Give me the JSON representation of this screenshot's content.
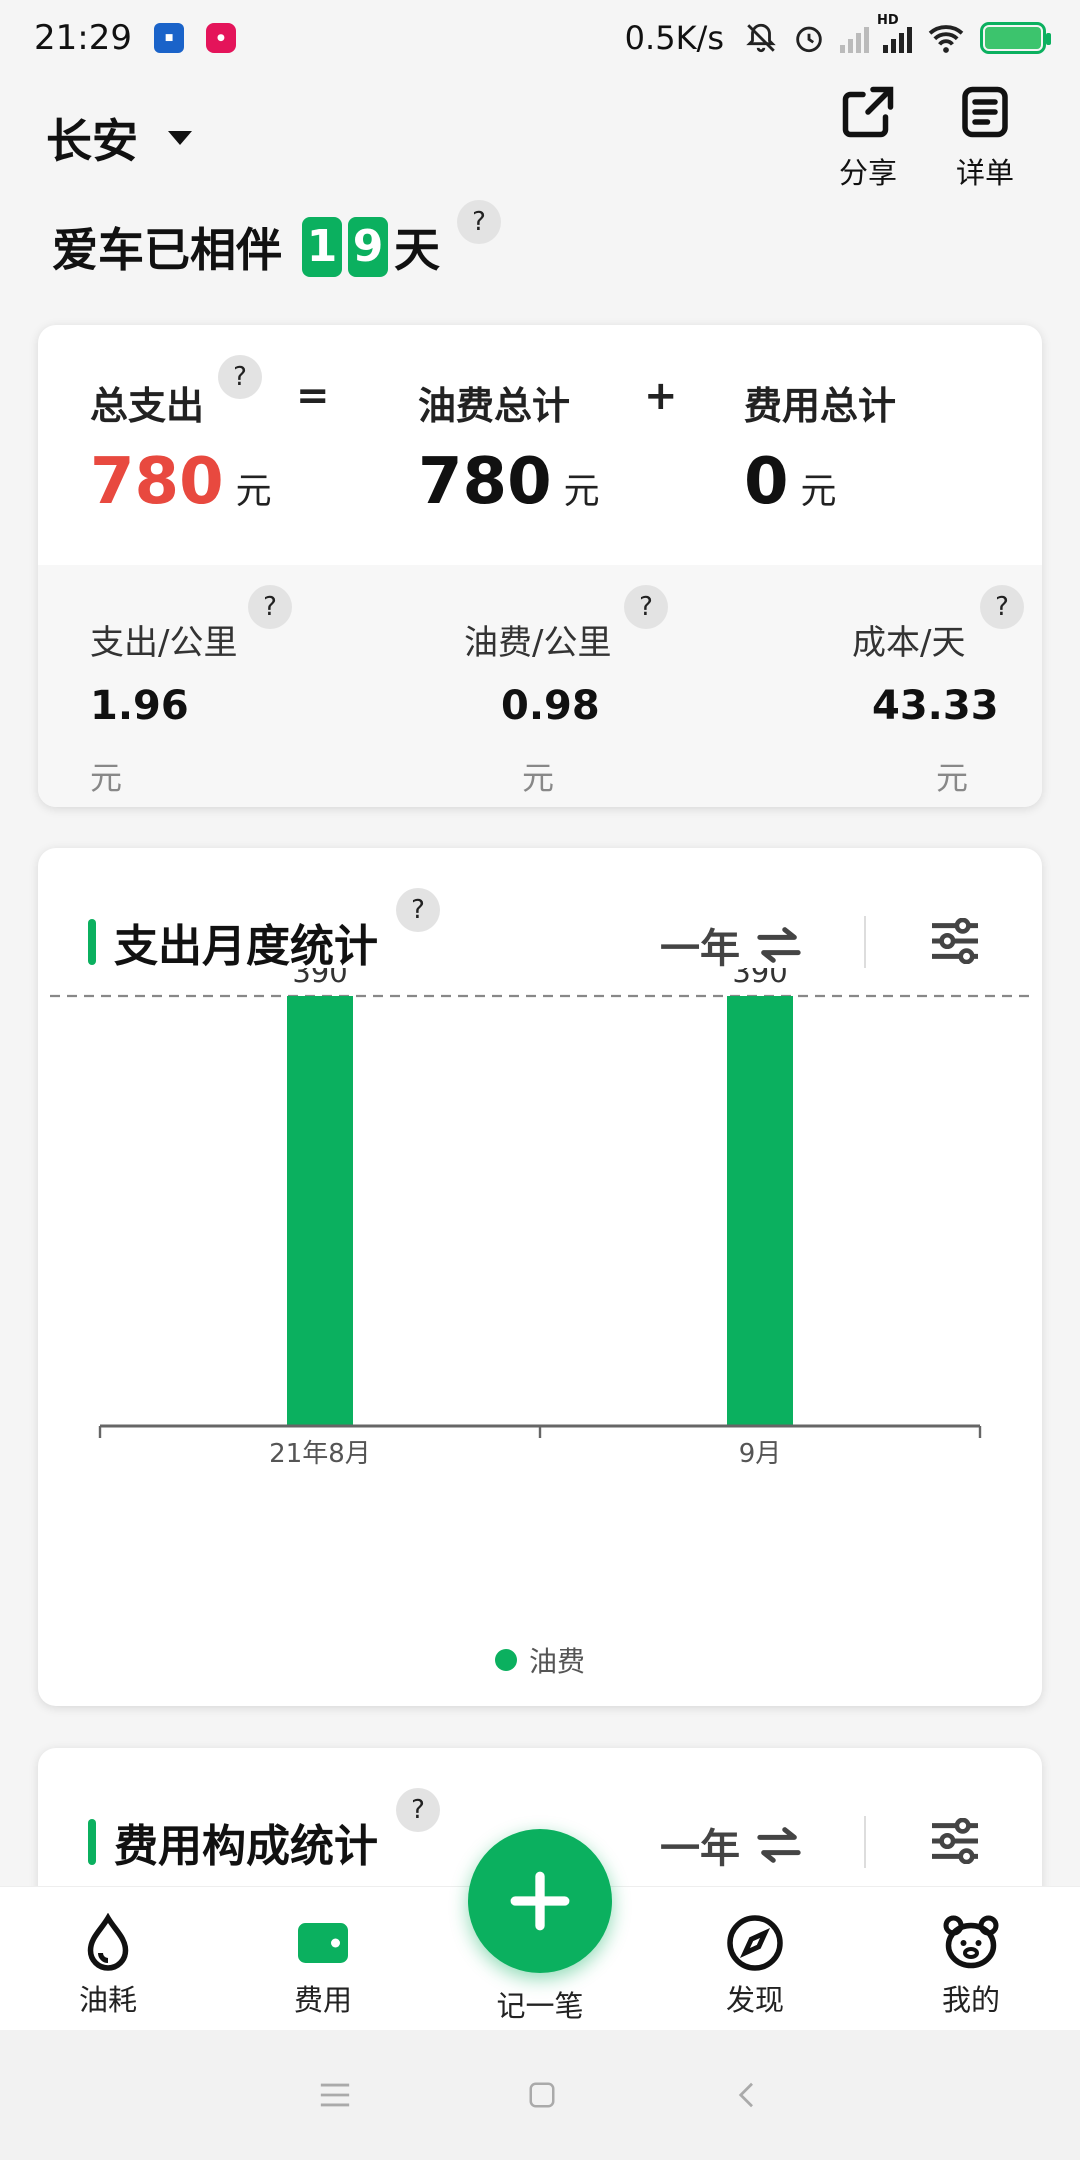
{
  "status_bar": {
    "time": "21:29",
    "net_speed": "0.5K/s",
    "network_label": "HD",
    "icons": [
      "mute-bell-icon",
      "alarm-icon",
      "signal-icon",
      "wifi-icon",
      "battery-charging-icon"
    ]
  },
  "header": {
    "brand": "长安",
    "share_label": "分享",
    "detail_label": "详单"
  },
  "companion": {
    "prefix": "爱车已相伴",
    "digits": [
      "1",
      "9"
    ],
    "suffix": "天"
  },
  "summary": {
    "total_label": "总支出",
    "equals": "=",
    "fuel_label": "油费总计",
    "plus": "+",
    "fee_label": "费用总计",
    "total_value": "780",
    "fuel_value": "780",
    "fee_value": "0",
    "unit": "元",
    "metrics": [
      {
        "label": "支出/公里",
        "value": "1.96",
        "unit": "元"
      },
      {
        "label": "油费/公里",
        "value": "0.98",
        "unit": "元"
      },
      {
        "label": "成本/天",
        "value": "43.33",
        "unit": "元"
      }
    ],
    "question": "?"
  },
  "monthly": {
    "title": "支出月度统计",
    "period": "一年",
    "legend": "油费",
    "accent": "#0bb05f"
  },
  "chart_data": {
    "type": "bar",
    "categories": [
      "21年8月",
      "9月"
    ],
    "series": [
      {
        "name": "油费",
        "values": [
          390,
          390
        ]
      }
    ],
    "data_labels": [
      "390",
      "390"
    ],
    "ylim": [
      0,
      390
    ],
    "reference_line": 390,
    "grid": false,
    "legend_position": "bottom"
  },
  "composition": {
    "title": "费用构成统计",
    "period": "一年"
  },
  "bottom_nav": {
    "items": [
      {
        "label": "油耗",
        "icon": "drop-icon"
      },
      {
        "label": "费用",
        "icon": "wallet-icon"
      },
      {
        "label": "记一笔",
        "icon": "plus-icon"
      },
      {
        "label": "发现",
        "icon": "compass-icon"
      },
      {
        "label": "我的",
        "icon": "bear-icon"
      }
    ]
  }
}
